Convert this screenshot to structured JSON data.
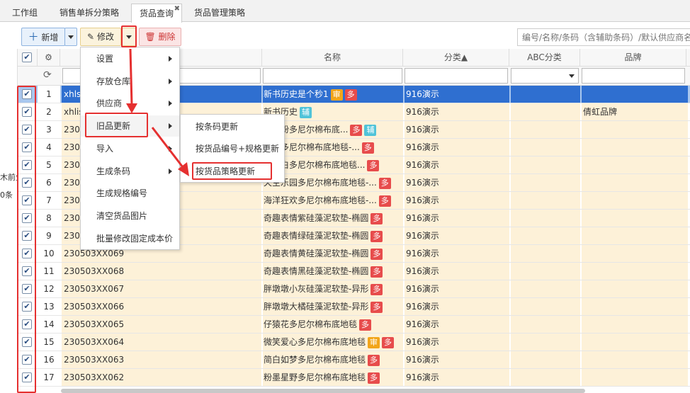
{
  "tabs": [
    {
      "label": "工作组"
    },
    {
      "label": "销售单拆分策略"
    },
    {
      "label": "货品查询"
    },
    {
      "label": "货品管理策略"
    }
  ],
  "toolbar": {
    "add": "新增",
    "edit": "修改",
    "delete": "删除",
    "search_placeholder": "编号/名称/条码（含辅助条码）/默认供应商名"
  },
  "left_fragments": [
    "木前生",
    "0条"
  ],
  "columns": {
    "name": "名称",
    "category": "分类▲",
    "abc": "ABC分类",
    "brand": "品牌"
  },
  "menu": [
    "设置",
    "存放仓库",
    "供应商",
    "旧品更新",
    "导入",
    "生成条码",
    "生成规格编号",
    "清空货品图片",
    "批量修改固定成本价"
  ],
  "submenu": [
    "按条码更新",
    "按货品编号+规格更新",
    "按货品策略更新"
  ],
  "rows": [
    {
      "num": "1",
      "code": "xhls",
      "name": "新书历史是个秒1",
      "cat": "916演示",
      "brand": "",
      "tags": [
        "审",
        "多"
      ]
    },
    {
      "num": "2",
      "code": "xhlis",
      "name": "新书历史",
      "cat": "916演示",
      "brand": "倩虹品牌",
      "tags": [
        "辅"
      ]
    },
    {
      "num": "3",
      "code": "230",
      "name": "地貌粉多尼尔棉布底...",
      "cat": "916演示",
      "brand": "",
      "tags": [
        "多",
        "辅"
      ]
    },
    {
      "num": "4",
      "code": "230",
      "name": "地貌多尼尔棉布底地毯-...",
      "cat": "916演示",
      "brand": "",
      "tags": [
        "多"
      ]
    },
    {
      "num": "5",
      "code": "230",
      "name": "地貌白多尼尔棉布底地毯...",
      "cat": "916演示",
      "brand": "",
      "tags": [
        "多"
      ]
    },
    {
      "num": "6",
      "code": "230",
      "name": "天空乐园多尼尔棉布底地毯-...",
      "cat": "916演示",
      "brand": "",
      "tags": [
        "多"
      ]
    },
    {
      "num": "7",
      "code": "230",
      "name": "海洋狂欢多尼尔棉布底地毯-...",
      "cat": "916演示",
      "brand": "",
      "tags": [
        "多"
      ]
    },
    {
      "num": "8",
      "code": "230",
      "name": "奇趣表情紫硅藻泥软垫-椭圆",
      "cat": "916演示",
      "brand": "",
      "tags": [
        "多"
      ]
    },
    {
      "num": "9",
      "code": "230",
      "name": "奇趣表情绿硅藻泥软垫-椭圆",
      "cat": "916演示",
      "brand": "",
      "tags": [
        "多"
      ]
    },
    {
      "num": "10",
      "code": "230503XX069",
      "name": "奇趣表情黄硅藻泥软垫-椭圆",
      "cat": "916演示",
      "brand": "",
      "tags": [
        "多"
      ]
    },
    {
      "num": "11",
      "code": "230503XX068",
      "name": "奇趣表情黑硅藻泥软垫-椭圆",
      "cat": "916演示",
      "brand": "",
      "tags": [
        "多"
      ]
    },
    {
      "num": "12",
      "code": "230503XX067",
      "name": "胖墩墩小灰硅藻泥软垫-异形",
      "cat": "916演示",
      "brand": "",
      "tags": [
        "多"
      ]
    },
    {
      "num": "13",
      "code": "230503XX066",
      "name": "胖墩墩大橘硅藻泥软垫-异形",
      "cat": "916演示",
      "brand": "",
      "tags": [
        "多"
      ]
    },
    {
      "num": "14",
      "code": "230503XX065",
      "name": "仔猿花多尼尔棉布底地毯",
      "cat": "916演示",
      "brand": "",
      "tags": [
        "多"
      ]
    },
    {
      "num": "15",
      "code": "230503XX064",
      "name": "微笑爱心多尼尔棉布底地毯",
      "cat": "916演示",
      "brand": "",
      "tags": [
        "审",
        "多"
      ]
    },
    {
      "num": "16",
      "code": "230503XX063",
      "name": "简白如梦多尼尔棉布底地毯",
      "cat": "916演示",
      "brand": "",
      "tags": [
        "多"
      ]
    },
    {
      "num": "17",
      "code": "230503XX062",
      "name": "粉墨星野多尼尔棉布底地毯",
      "cat": "916演示",
      "brand": "",
      "tags": [
        "多"
      ]
    }
  ]
}
